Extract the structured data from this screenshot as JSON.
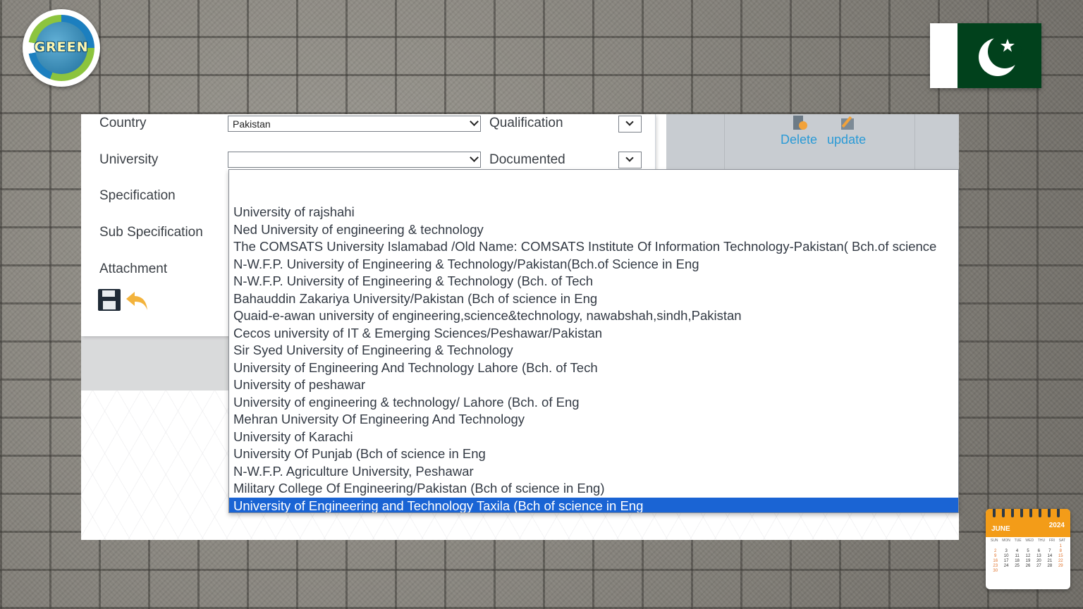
{
  "logo": {
    "text": "GREEN"
  },
  "form": {
    "country_label": "Country",
    "country_value": "Pakistan",
    "university_label": "University",
    "university_value": "",
    "specification_label": "Specification",
    "sub_specification_label": "Sub Specification",
    "attachment_label": "Attachment",
    "qualification_label": "Qualification",
    "documented_label": "Documented"
  },
  "toolbar": {
    "delete_label": "Delete",
    "update_label": "update"
  },
  "university_options": [
    "",
    "University of rajshahi",
    "Ned University of engineering & technology",
    "The COMSATS University Islamabad /Old Name: COMSATS Institute Of Information Technology-Pakistan( Bch.of science",
    "N-W.F.P. University of Engineering & Technology/Pakistan(Bch.of Science in Eng",
    "N-W.F.P. University of Engineering & Technology (Bch. of Tech",
    "Bahauddin Zakariya University/Pakistan (Bch of science in Eng",
    "Quaid-e-awan university of engineering,science&technology, nawabshah,sindh,Pakistan",
    "Cecos university of IT & Emerging Sciences/Peshawar/Pakistan",
    "Sir Syed University of Engineering & Technology",
    "University of Engineering And Technology Lahore (Bch. of Tech",
    "University of peshawar",
    "University of engineering & technology/ Lahore (Bch. of Eng",
    "Mehran University Of Engineering And Technology",
    "University of Karachi",
    "University Of Punjab (Bch of science in Eng",
    "N-W.F.P. Agriculture University, Peshawar",
    "Military College Of Engineering/Pakistan (Bch of science in Eng)",
    "University of Engineering and Technology Taxila (Bch of science in Eng"
  ],
  "selected_option_index": 18,
  "calendar": {
    "month": "JUNE",
    "year": "2024",
    "weekdays": [
      "SUN",
      "MON",
      "TUE",
      "WED",
      "THU",
      "FRI",
      "SAT"
    ],
    "days": [
      "",
      "",
      "",
      "",
      "",
      "",
      "1",
      "2",
      "3",
      "4",
      "5",
      "6",
      "7",
      "8",
      "9",
      "10",
      "11",
      "12",
      "13",
      "14",
      "15",
      "16",
      "17",
      "18",
      "19",
      "20",
      "21",
      "22",
      "23",
      "24",
      "25",
      "26",
      "27",
      "28",
      "29",
      "30"
    ]
  },
  "colors": {
    "accent_link": "#2a9ad6",
    "selected_bg": "#1a64d4",
    "flag_green": "#01411c",
    "calendar_orange": "#f39c18"
  }
}
